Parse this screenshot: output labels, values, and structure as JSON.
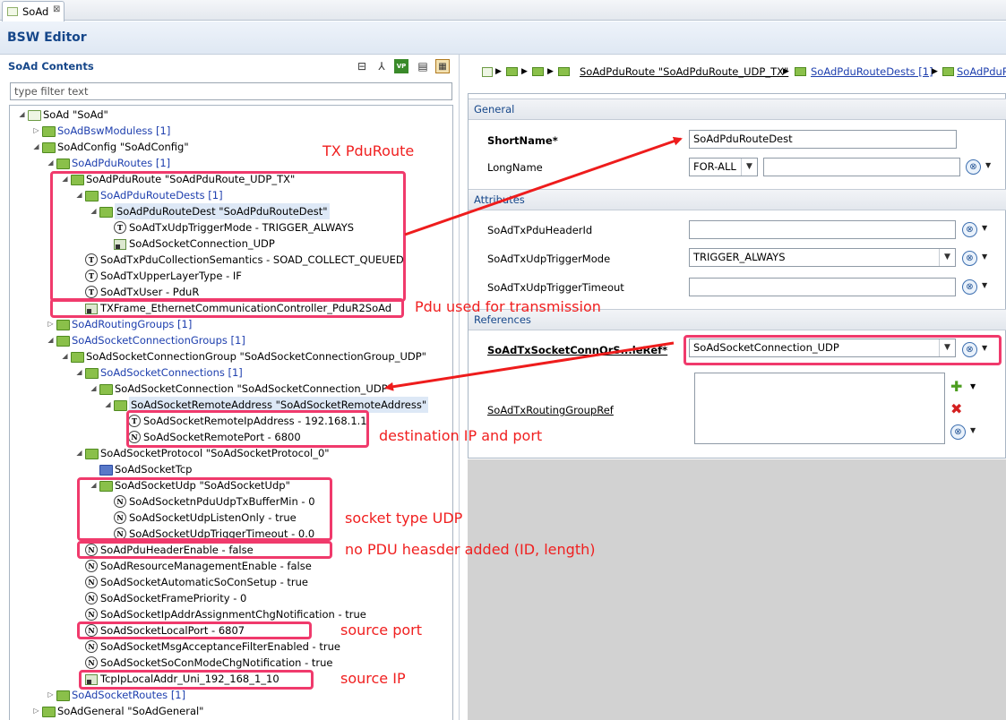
{
  "tab": {
    "label": "SoAd",
    "close": "⊠"
  },
  "editor_title": "BSW Editor",
  "contents": {
    "title": "SoAd Contents",
    "filter_placeholder": "type filter text"
  },
  "tree": [
    {
      "t": "SoAd \"SoAd\""
    },
    {
      "t": "SoAdBswModuless [1]"
    },
    {
      "t": "SoAdConfig \"SoAdConfig\""
    },
    {
      "t": "SoAdPduRoutes [1]"
    },
    {
      "t": "SoAdPduRoute \"SoAdPduRoute_UDP_TX\""
    },
    {
      "t": "SoAdPduRouteDests [1]"
    },
    {
      "t": "SoAdPduRouteDest \"SoAdPduRouteDest\""
    },
    {
      "t": "SoAdTxUdpTriggerMode - TRIGGER_ALWAYS"
    },
    {
      "t": "SoAdSocketConnection_UDP"
    },
    {
      "t": "SoAdTxPduCollectionSemantics - SOAD_COLLECT_QUEUED"
    },
    {
      "t": "SoAdTxUpperLayerType - IF"
    },
    {
      "t": "SoAdTxUser - PduR"
    },
    {
      "t": "TXFrame_EthernetCommunicationController_PduR2SoAd"
    },
    {
      "t": "SoAdRoutingGroups [1]"
    },
    {
      "t": "SoAdSocketConnectionGroups [1]"
    },
    {
      "t": "SoAdSocketConnectionGroup \"SoAdSocketConnectionGroup_UDP\""
    },
    {
      "t": "SoAdSocketConnections [1]"
    },
    {
      "t": "SoAdSocketConnection \"SoAdSocketConnection_UDP\""
    },
    {
      "t": "SoAdSocketRemoteAddress \"SoAdSocketRemoteAddress\""
    },
    {
      "t": "SoAdSocketRemoteIpAddress - 192.168.1.1"
    },
    {
      "t": "SoAdSocketRemotePort - 6800"
    },
    {
      "t": "SoAdSocketProtocol \"SoAdSocketProtocol_0\""
    },
    {
      "t": "SoAdSocketTcp"
    },
    {
      "t": "SoAdSocketUdp \"SoAdSocketUdp\""
    },
    {
      "t": "SoAdSocketnPduUdpTxBufferMin - 0"
    },
    {
      "t": "SoAdSocketUdpListenOnly - true"
    },
    {
      "t": "SoAdSocketUdpTriggerTimeout - 0.0"
    },
    {
      "t": "SoAdPduHeaderEnable - false"
    },
    {
      "t": "SoAdResourceManagementEnable - false"
    },
    {
      "t": "SoAdSocketAutomaticSoConSetup - true"
    },
    {
      "t": "SoAdSocketFramePriority - 0"
    },
    {
      "t": "SoAdSocketIpAddrAssignmentChgNotification - true"
    },
    {
      "t": "SoAdSocketLocalPort - 6807"
    },
    {
      "t": "SoAdSocketMsgAcceptanceFilterEnabled - true"
    },
    {
      "t": "SoAdSocketSoConModeChgNotification - true"
    },
    {
      "t": "TcpIpLocalAddr_Uni_192_168_1_10"
    },
    {
      "t": "SoAdSocketRoutes [1]"
    },
    {
      "t": "SoAdGeneral \"SoAdGeneral\""
    }
  ],
  "icon_letters": {
    "param_text": "T",
    "param_num": "N"
  },
  "breadcrumb": {
    "route": "SoAdPduRoute \"SoAdPduRoute_UDP_TX\"",
    "dests": "SoAdPduRouteDests [1]",
    "next": "SoAdPduRou"
  },
  "form": {
    "general": {
      "title": "General",
      "shortname_label": "ShortName*",
      "shortname_value": "SoAdPduRouteDest",
      "longname_label": "LongName",
      "lang": "FOR-ALL",
      "longname_value": ""
    },
    "attributes": {
      "title": "Attributes",
      "header_id_label": "SoAdTxPduHeaderId",
      "header_id_value": "",
      "trigger_mode_label": "SoAdTxUdpTriggerMode",
      "trigger_mode_value": "TRIGGER_ALWAYS",
      "trigger_timeout_label": "SoAdTxUdpTriggerTimeout",
      "trigger_timeout_value": ""
    },
    "references": {
      "title": "References",
      "conn_ref_label": "SoAdTxSocketConnOrS...leRef*",
      "conn_ref_value": "SoAdSocketConnection_UDP",
      "routing_group_label": "SoAdTxRoutingGroupRef"
    }
  },
  "annotations": {
    "tx_pduroute": "TX PduRoute",
    "pdu_used": "Pdu used for transmission",
    "dest_ip_port": "destination IP and port",
    "socket_udp": "socket type UDP",
    "no_header": "no PDU heasder added (ID, length)",
    "source_port": "source port",
    "source_ip": "source IP"
  },
  "colors": {
    "annotation": "#f02020",
    "highlight": "#f03a6c",
    "title": "#16478a"
  }
}
